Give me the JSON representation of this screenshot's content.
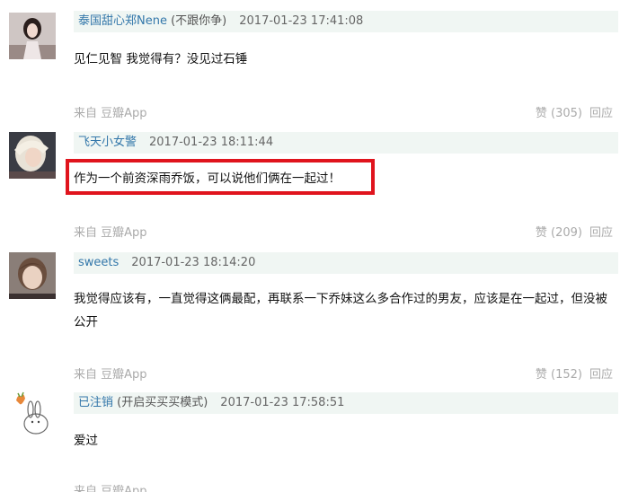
{
  "comments": [
    {
      "author": "泰国甜心郑Nene",
      "signature": " (不跟你争)",
      "time": "2017-01-23 17:41:08",
      "content": "见仁见智 我觉得有？没见过石锤",
      "source": "来自 豆瓣App",
      "vote": "赞 (305)",
      "reply": "回应"
    },
    {
      "author": "飞天小女警",
      "signature": "",
      "time": "2017-01-23 18:11:44",
      "content": "作为一个前资深雨乔饭，可以说他们俩在一起过！",
      "source": "来自 豆瓣App",
      "vote": "赞 (209)",
      "reply": "回应"
    },
    {
      "author": "sweets",
      "signature": "",
      "time": "2017-01-23 18:14:20",
      "content": "我觉得应该有，一直觉得这俩最配，再联系一下乔妹这么多合作过的男友，应该是在一起过，但没被公开",
      "source": "来自 豆瓣App",
      "vote": "赞 (152)",
      "reply": "回应"
    },
    {
      "author": "已注销",
      "signature": " (开启买买买模式)",
      "time": "2017-01-23 17:58:51",
      "content": "爱过",
      "source": "来自 豆瓣App"
    }
  ],
  "colors": {
    "author": "#3377aa",
    "meta_bar": "#f0f6f3",
    "highlight": "#e0141d",
    "muted": "#aaaaaa"
  }
}
